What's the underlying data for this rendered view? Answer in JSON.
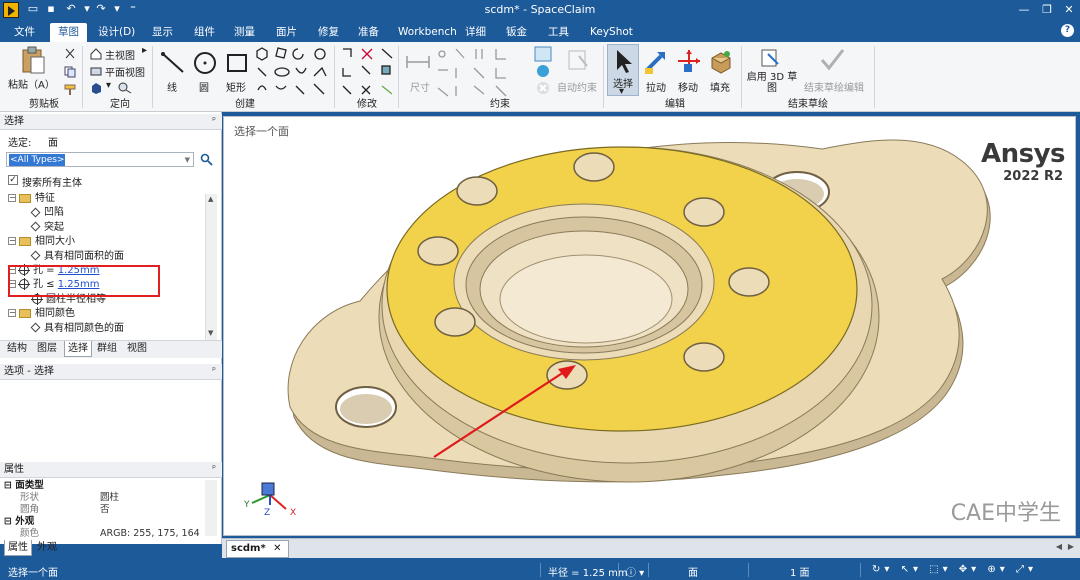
{
  "window": {
    "title": "scdm* - SpaceClaim",
    "qa_icons": [
      "app-logo",
      "open-icon",
      "save-icon",
      "undo-icon",
      "redo-icon",
      "customize-icon"
    ]
  },
  "ribbon_tabs": [
    "文件",
    "草图",
    "设计(D)",
    "显示",
    "组件",
    "测量",
    "面片",
    "修复",
    "准备",
    "Workbench",
    "详细",
    "钣金",
    "工具",
    "KeyShot"
  ],
  "active_tab": "草图",
  "ribbon": {
    "clipboard": {
      "paste_label": "粘贴（A）",
      "group": "剪贴板"
    },
    "orient": {
      "home_view": "主视图",
      "plan_view": "平面视图",
      "group": "定向"
    },
    "create": {
      "line": "线",
      "circle": "圆",
      "rect": "矩形",
      "group": "创建"
    },
    "modify": {
      "group": "修改"
    },
    "constrain": {
      "dimension": "尺寸",
      "auto": "自动约束",
      "group": "约束"
    },
    "edit": {
      "select": "选择",
      "pull": "拉动",
      "move": "移动",
      "fill": "填充",
      "group": "编辑"
    },
    "finish": {
      "enable3d": "启用 3D 草图",
      "finish_edit": "结束草绘编辑",
      "group": "结束草绘"
    }
  },
  "select_panel": {
    "title": "选择",
    "selected_label": "选定:",
    "selected_value": "面",
    "type_filter": "<All Types>",
    "search_all_label": "搜索所有主体",
    "tree": [
      {
        "label": "特征",
        "level": 0,
        "icon": "folder"
      },
      {
        "label": "凹陷",
        "level": 1,
        "icon": "diamond"
      },
      {
        "label": "突起",
        "level": 1,
        "icon": "diamond"
      },
      {
        "label": "相同大小",
        "level": 0,
        "icon": "folder"
      },
      {
        "label": "具有相同面积的面",
        "level": 1,
        "icon": "diamond"
      },
      {
        "label": "孔 = ",
        "link": "1.25mm",
        "level": 0,
        "icon": "hole"
      },
      {
        "label": "孔 ≤ ",
        "link": "1.25mm",
        "level": 0,
        "icon": "hole"
      },
      {
        "label": "圆柱半径相等",
        "level": 1,
        "icon": "hole"
      },
      {
        "label": "相同颜色",
        "level": 0,
        "icon": "folder"
      },
      {
        "label": "具有相同颜色的面",
        "level": 1,
        "icon": "diamond"
      }
    ]
  },
  "panel_tabs": [
    "结构",
    "图层",
    "选择",
    "群组",
    "视图"
  ],
  "active_panel_tab": "选择",
  "options_panel": {
    "title": "选项 - 选择"
  },
  "props_panel": {
    "title": "属性",
    "rows": [
      {
        "cat": "面类型"
      },
      {
        "k": "形状",
        "v": "圆柱"
      },
      {
        "k": "圆角",
        "v": "否"
      },
      {
        "cat": "外观"
      },
      {
        "k": "颜色",
        "v": "ARGB: 255, 175, 164"
      }
    ],
    "tabs": [
      "属性",
      "外观"
    ]
  },
  "viewport": {
    "hint": "选择一个面",
    "logo": "Ansys",
    "version": "2022 R2",
    "watermark": "CAE中学生",
    "axes": {
      "x": "X",
      "y": "Y",
      "z": "Z"
    }
  },
  "doc_tab": "scdm*",
  "status": {
    "left": "选择一个面",
    "radius": "半径 = 1.25 mm",
    "face": "面",
    "count": "1 面"
  },
  "colors": {
    "chrome": "#1d5a9a",
    "face_yellow": "#f2d24a",
    "part": "#ecdcb8"
  }
}
